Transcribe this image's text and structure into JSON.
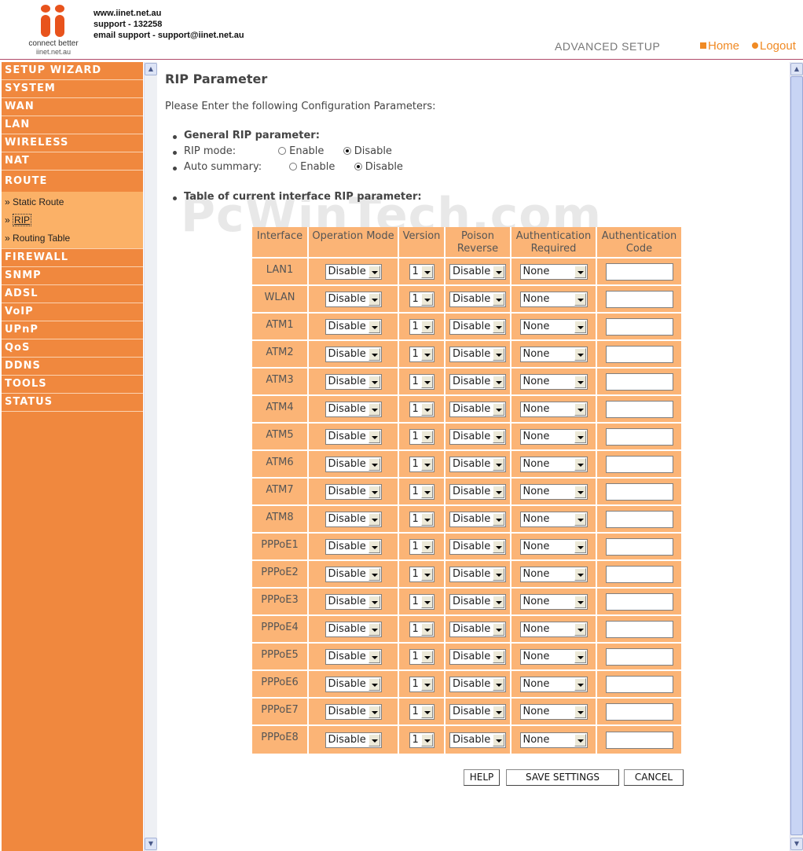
{
  "header": {
    "logo_tagline": "connect better",
    "logo_site": "iinet.net.au",
    "contact_lines": [
      "www.iinet.net.au",
      "support - 132258",
      "email support - support@iinet.net.au"
    ],
    "section_title": "ADVANCED SETUP",
    "home_label": "Home",
    "logout_label": "Logout"
  },
  "sidebar": {
    "items_top": [
      "SETUP WIZARD",
      "SYSTEM",
      "WAN",
      "LAN",
      "WIRELESS",
      "NAT",
      "ROUTE"
    ],
    "submenu": [
      "Static Route",
      "RIP",
      "Routing Table"
    ],
    "active_sub": "RIP",
    "items_bottom": [
      "FIREWALL",
      "SNMP",
      "ADSL",
      "VoIP",
      "UPnP",
      "QoS",
      "DDNS",
      "TOOLS",
      "STATUS"
    ],
    "sub_prefix": "»"
  },
  "main": {
    "title": "RIP Parameter",
    "intro": "Please Enter the following Configuration Parameters:",
    "general_label": "General RIP parameter:",
    "rip_mode_label": "RIP mode:",
    "auto_summary_label": "Auto summary:",
    "enable_label": "Enable",
    "disable_label": "Disable",
    "rip_mode_value": "Disable",
    "auto_summary_value": "Disable",
    "table_label": "Table of current interface RIP parameter:",
    "watermark": "PcWinTech.com"
  },
  "table": {
    "headers": [
      "Interface",
      "Operation Mode",
      "Version",
      "Poison Reverse",
      "Authentication Required",
      "Authentication Code"
    ],
    "rows": [
      {
        "interface": "LAN1",
        "op_mode": "Disable",
        "version": "1",
        "poison": "Disable",
        "auth": "None",
        "code": ""
      },
      {
        "interface": "WLAN",
        "op_mode": "Disable",
        "version": "1",
        "poison": "Disable",
        "auth": "None",
        "code": ""
      },
      {
        "interface": "ATM1",
        "op_mode": "Disable",
        "version": "1",
        "poison": "Disable",
        "auth": "None",
        "code": ""
      },
      {
        "interface": "ATM2",
        "op_mode": "Disable",
        "version": "1",
        "poison": "Disable",
        "auth": "None",
        "code": ""
      },
      {
        "interface": "ATM3",
        "op_mode": "Disable",
        "version": "1",
        "poison": "Disable",
        "auth": "None",
        "code": ""
      },
      {
        "interface": "ATM4",
        "op_mode": "Disable",
        "version": "1",
        "poison": "Disable",
        "auth": "None",
        "code": ""
      },
      {
        "interface": "ATM5",
        "op_mode": "Disable",
        "version": "1",
        "poison": "Disable",
        "auth": "None",
        "code": ""
      },
      {
        "interface": "ATM6",
        "op_mode": "Disable",
        "version": "1",
        "poison": "Disable",
        "auth": "None",
        "code": ""
      },
      {
        "interface": "ATM7",
        "op_mode": "Disable",
        "version": "1",
        "poison": "Disable",
        "auth": "None",
        "code": ""
      },
      {
        "interface": "ATM8",
        "op_mode": "Disable",
        "version": "1",
        "poison": "Disable",
        "auth": "None",
        "code": ""
      },
      {
        "interface": "PPPoE1",
        "op_mode": "Disable",
        "version": "1",
        "poison": "Disable",
        "auth": "None",
        "code": ""
      },
      {
        "interface": "PPPoE2",
        "op_mode": "Disable",
        "version": "1",
        "poison": "Disable",
        "auth": "None",
        "code": ""
      },
      {
        "interface": "PPPoE3",
        "op_mode": "Disable",
        "version": "1",
        "poison": "Disable",
        "auth": "None",
        "code": ""
      },
      {
        "interface": "PPPoE4",
        "op_mode": "Disable",
        "version": "1",
        "poison": "Disable",
        "auth": "None",
        "code": ""
      },
      {
        "interface": "PPPoE5",
        "op_mode": "Disable",
        "version": "1",
        "poison": "Disable",
        "auth": "None",
        "code": ""
      },
      {
        "interface": "PPPoE6",
        "op_mode": "Disable",
        "version": "1",
        "poison": "Disable",
        "auth": "None",
        "code": ""
      },
      {
        "interface": "PPPoE7",
        "op_mode": "Disable",
        "version": "1",
        "poison": "Disable",
        "auth": "None",
        "code": ""
      },
      {
        "interface": "PPPoE8",
        "op_mode": "Disable",
        "version": "1",
        "poison": "Disable",
        "auth": "None",
        "code": ""
      }
    ]
  },
  "buttons": {
    "help": "HELP",
    "save": "SAVE SETTINGS",
    "cancel": "CANCEL"
  },
  "colors": {
    "accent": "#f0883e",
    "submenu_bg": "#fbb167",
    "table_bg": "#fbb476",
    "link": "#f08a24",
    "logo": "#e8531c"
  },
  "icons": {
    "home": "square-bullet-icon",
    "logout": "circle-bullet-icon",
    "scroll_up": "scroll-up-arrow-icon",
    "scroll_down": "scroll-down-arrow-icon",
    "select_arrow": "dropdown-arrow-icon"
  }
}
